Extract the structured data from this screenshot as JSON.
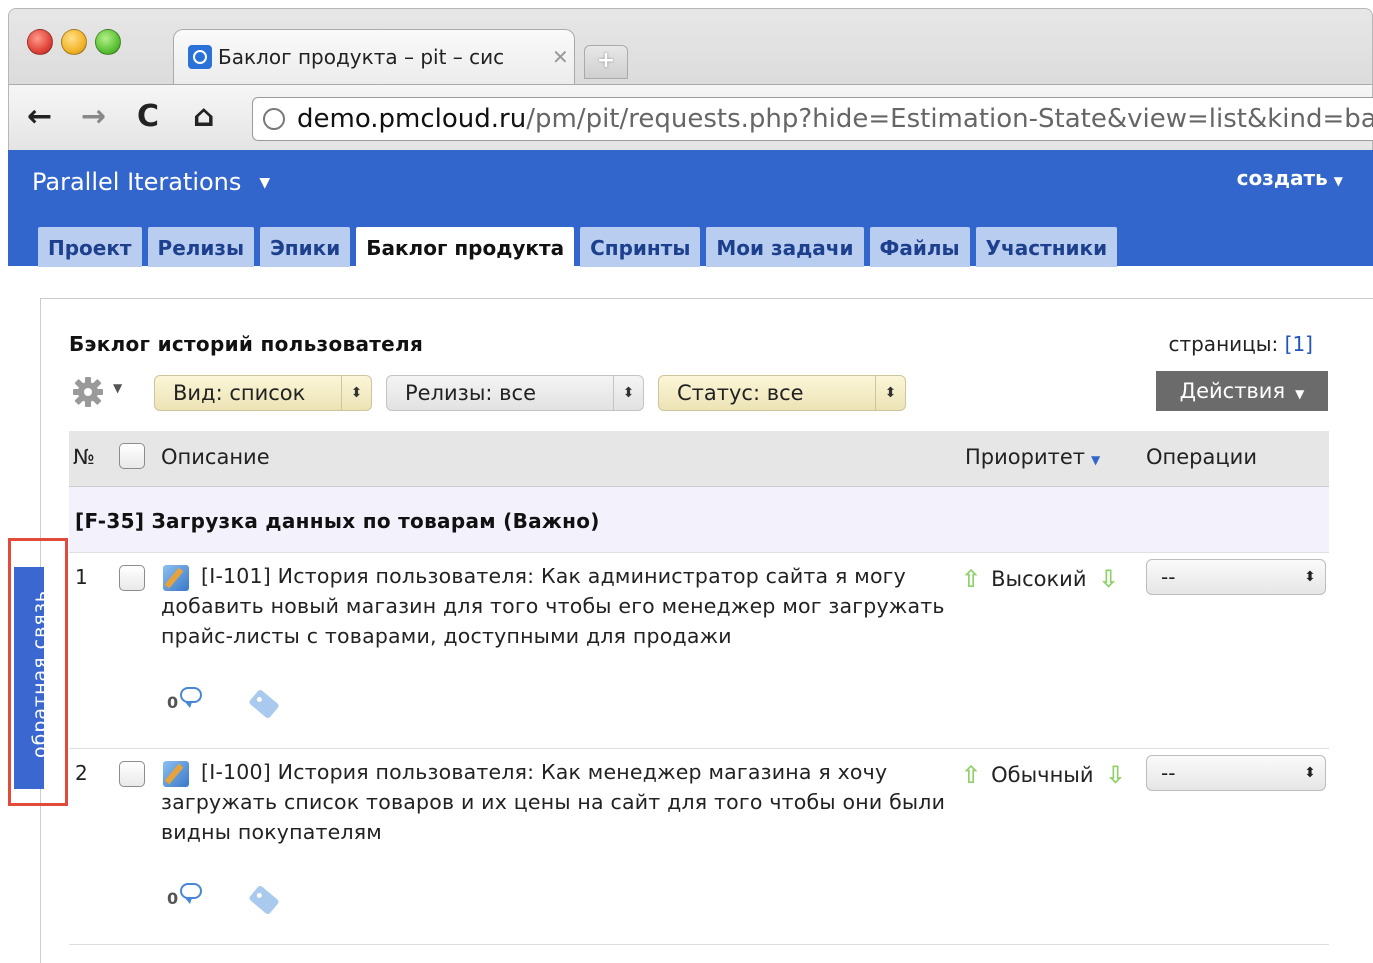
{
  "browser": {
    "tab_title": "Баклог продукта – pit – сис",
    "tab_close": "✕",
    "new_tab": "+",
    "back": "←",
    "forward": "→",
    "reload": "C",
    "home": "⌂",
    "url_host": "demo.pmcloud.ru",
    "url_path": "/pm/pit/requests.php?hide=Estimation-State&view=list&kind=bac"
  },
  "app": {
    "title": "Parallel Iterations",
    "create_label": "создать",
    "tabs": [
      {
        "label": "Проект"
      },
      {
        "label": "Релизы"
      },
      {
        "label": "Эпики"
      },
      {
        "label": "Баклог продукта",
        "active": true
      },
      {
        "label": "Спринты"
      },
      {
        "label": "Мои задачи"
      },
      {
        "label": "Файлы"
      },
      {
        "label": "Участники"
      }
    ]
  },
  "list": {
    "title": "Бэклог историй пользователя",
    "pages_label": "страницы:",
    "pages_link": "[1]",
    "filters": {
      "view": "Вид: список",
      "releases": "Релизы: все",
      "status": "Статус: все"
    },
    "actions_label": "Действия",
    "columns": {
      "num": "№",
      "description": "Описание",
      "priority": "Приоритет",
      "operations": "Операции"
    },
    "group_title": "[F-35] Загрузка данных по товарам (Важно)",
    "rows": [
      {
        "num": "1",
        "description": "[I-101] История пользователя: Как администратор сайта я могу добавить новый магазин для того чтобы его менеджер мог загружать прайс-листы с товарами, доступными для продажи",
        "priority": "Высокий",
        "operation": "--",
        "comments": "0"
      },
      {
        "num": "2",
        "description": "[I-100] История пользователя: Как менеджер магазина я хочу загружать список товаров и их цены на сайт для того чтобы они были видны покупателям",
        "priority": "Обычный",
        "operation": "--",
        "comments": "0"
      }
    ]
  },
  "feedback_label": "обратная связь",
  "colors": {
    "header_blue": "#3366cc",
    "feedback_outline": "#e24a3b",
    "actions_bg": "#6b6b6b"
  }
}
